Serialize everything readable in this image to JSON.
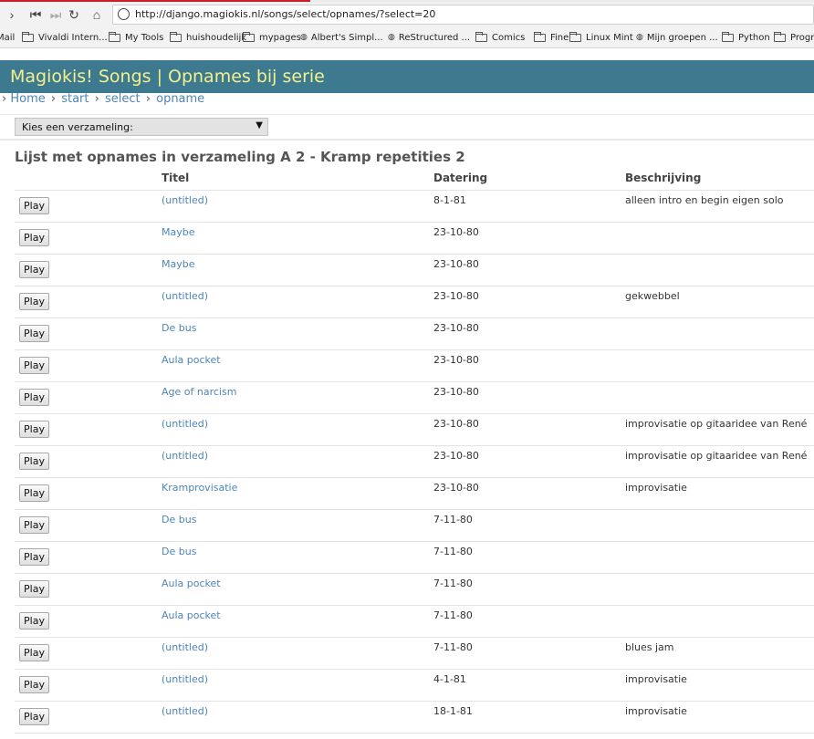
{
  "browser": {
    "url": "http://django.magiokis.nl/songs/select/opnames/?select=20",
    "bookmarks": [
      {
        "label": "Mail",
        "type": "none"
      },
      {
        "label": "Vivaldi Intern...",
        "type": "folder"
      },
      {
        "label": "My Tools",
        "type": "folder"
      },
      {
        "label": "huishoudelijk",
        "type": "folder"
      },
      {
        "label": "mypages",
        "type": "folder"
      },
      {
        "label": "Albert's Simpl...",
        "type": "site"
      },
      {
        "label": "ReStructured ...",
        "type": "site"
      },
      {
        "label": "Comics",
        "type": "folder"
      },
      {
        "label": "Fine",
        "type": "folder"
      },
      {
        "label": "Linux Mint",
        "type": "folder"
      },
      {
        "label": "Mijn groepen ...",
        "type": "site"
      },
      {
        "label": "Python",
        "type": "folder"
      },
      {
        "label": "Progra",
        "type": "folder"
      }
    ]
  },
  "header": {
    "title": "Magiokis! Songs | Opnames bij serie"
  },
  "breadcrumb": {
    "prefix": "›",
    "sep": "›",
    "items": [
      "Home",
      "start",
      "select",
      "opname"
    ]
  },
  "collection_select": {
    "label": "Kies een verzameling:"
  },
  "list": {
    "heading": "Lijst met opnames in verzameling A 2 - Kramp repetities 2",
    "columns": {
      "title": "Titel",
      "date": "Datering",
      "description": "Beschrijving"
    },
    "play_label": "Play",
    "rows": [
      {
        "title": "(untitled)",
        "date": "8-1-81",
        "description": "alleen intro en begin eigen solo"
      },
      {
        "title": "Maybe",
        "date": "23-10-80",
        "description": ""
      },
      {
        "title": "Maybe",
        "date": "23-10-80",
        "description": ""
      },
      {
        "title": "(untitled)",
        "date": "23-10-80",
        "description": "gekwebbel"
      },
      {
        "title": "De bus",
        "date": "23-10-80",
        "description": ""
      },
      {
        "title": "Aula pocket",
        "date": "23-10-80",
        "description": ""
      },
      {
        "title": "Age of narcism",
        "date": "23-10-80",
        "description": ""
      },
      {
        "title": "(untitled)",
        "date": "23-10-80",
        "description": "improvisatie op gitaaridee van René"
      },
      {
        "title": "(untitled)",
        "date": "23-10-80",
        "description": "improvisatie op gitaaridee van René"
      },
      {
        "title": "Kramprovisatie",
        "date": "23-10-80",
        "description": "improvisatie"
      },
      {
        "title": "De bus",
        "date": "7-11-80",
        "description": ""
      },
      {
        "title": "De bus",
        "date": "7-11-80",
        "description": ""
      },
      {
        "title": "Aula pocket",
        "date": "7-11-80",
        "description": ""
      },
      {
        "title": "Aula pocket",
        "date": "7-11-80",
        "description": ""
      },
      {
        "title": "(untitled)",
        "date": "7-11-80",
        "description": "blues jam"
      },
      {
        "title": "(untitled)",
        "date": "4-1-81",
        "description": "improvisatie"
      },
      {
        "title": "(untitled)",
        "date": "18-1-81",
        "description": "improvisatie"
      }
    ]
  },
  "colors": {
    "header_bg": "#3e7a8f",
    "header_text": "#f2f08f",
    "link": "#4d85b9"
  }
}
